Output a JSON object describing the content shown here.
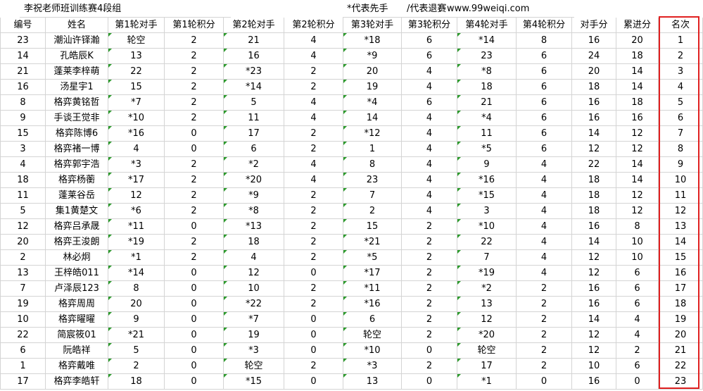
{
  "sheet": {
    "title": "李祝老师班训练赛4段组",
    "legend_first": "*代表先手",
    "legend_quit": "/代表退赛",
    "legend_site": "：www.99weiqi.com",
    "headers": [
      "编号",
      "姓名",
      "第1轮对手",
      "第1轮积分",
      "第2轮对手",
      "第2轮积分",
      "第3轮对手",
      "第3轮积分",
      "第4轮对手",
      "第4轮积分",
      "对手分",
      "累进分",
      "名次"
    ],
    "rows": [
      [
        "23",
        "潮汕许铎瀚",
        "轮空",
        "2",
        "21",
        "4",
        "*18",
        "6",
        "*14",
        "8",
        "16",
        "20",
        "1"
      ],
      [
        "14",
        "孔皓辰K",
        "13",
        "2",
        "16",
        "4",
        "*9",
        "6",
        "23",
        "6",
        "24",
        "18",
        "2"
      ],
      [
        "21",
        "蓬莱李梓萌",
        "22",
        "2",
        "*23",
        "2",
        "20",
        "4",
        "*8",
        "6",
        "20",
        "14",
        "3"
      ],
      [
        "16",
        "汤星宇1",
        "15",
        "2",
        "*14",
        "2",
        "19",
        "4",
        "18",
        "6",
        "18",
        "14",
        "4"
      ],
      [
        "8",
        "格弈黄铭哲",
        "*7",
        "2",
        "5",
        "4",
        "*4",
        "6",
        "21",
        "6",
        "16",
        "18",
        "5"
      ],
      [
        "9",
        "手谈王觉非",
        "*10",
        "2",
        "11",
        "4",
        "14",
        "4",
        "*4",
        "6",
        "16",
        "16",
        "6"
      ],
      [
        "15",
        "格弈陈博6",
        "*16",
        "0",
        "17",
        "2",
        "*12",
        "4",
        "11",
        "6",
        "14",
        "12",
        "7"
      ],
      [
        "3",
        "格弈褚一博",
        "4",
        "0",
        "6",
        "2",
        "1",
        "4",
        "*5",
        "6",
        "12",
        "12",
        "8"
      ],
      [
        "4",
        "格弈郭宇浩",
        "*3",
        "2",
        "*2",
        "4",
        "8",
        "4",
        "9",
        "4",
        "22",
        "14",
        "9"
      ],
      [
        "18",
        "格弈杨蘅",
        "*17",
        "2",
        "*20",
        "4",
        "23",
        "4",
        "*16",
        "4",
        "18",
        "14",
        "10"
      ],
      [
        "11",
        "蓬莱谷岳",
        "12",
        "2",
        "*9",
        "2",
        "7",
        "4",
        "*15",
        "4",
        "18",
        "12",
        "11"
      ],
      [
        "5",
        "集1黄楚文",
        "*6",
        "2",
        "*8",
        "2",
        "2",
        "4",
        "3",
        "4",
        "18",
        "12",
        "12"
      ],
      [
        "12",
        "格弈吕承晟",
        "*11",
        "0",
        "*13",
        "2",
        "15",
        "2",
        "*10",
        "4",
        "16",
        "8",
        "13"
      ],
      [
        "20",
        "格弈王浚朗",
        "*19",
        "2",
        "18",
        "2",
        "*21",
        "2",
        "22",
        "4",
        "14",
        "10",
        "14"
      ],
      [
        "2",
        "林必炯",
        "*1",
        "2",
        "4",
        "2",
        "*5",
        "2",
        "7",
        "4",
        "12",
        "10",
        "15"
      ],
      [
        "13",
        "王梓皓011",
        "*14",
        "0",
        "12",
        "0",
        "*17",
        "2",
        "*19",
        "4",
        "12",
        "6",
        "16"
      ],
      [
        "7",
        "卢泽辰123",
        "8",
        "0",
        "10",
        "2",
        "*11",
        "2",
        "*2",
        "2",
        "16",
        "6",
        "17"
      ],
      [
        "19",
        "格弈周周",
        "20",
        "0",
        "*22",
        "2",
        "*16",
        "2",
        "13",
        "2",
        "16",
        "6",
        "18"
      ],
      [
        "10",
        "格弈曜曜",
        "9",
        "0",
        "*7",
        "0",
        "6",
        "2",
        "12",
        "2",
        "14",
        "4",
        "19"
      ],
      [
        "22",
        "简宸筱01",
        "*21",
        "0",
        "19",
        "0",
        "轮空",
        "2",
        "*20",
        "2",
        "12",
        "4",
        "20"
      ],
      [
        "6",
        "阮皓祥",
        "5",
        "0",
        "*3",
        "0",
        "*10",
        "0",
        "轮空",
        "2",
        "12",
        "2",
        "21"
      ],
      [
        "1",
        "格弈戴唯",
        "2",
        "0",
        "轮空",
        "2",
        "*3",
        "2",
        "17",
        "2",
        "10",
        "6",
        "22"
      ],
      [
        "17",
        "格弈李皓轩",
        "18",
        "0",
        "*15",
        "0",
        "13",
        "0",
        "*1",
        "0",
        "16",
        "0",
        "23"
      ]
    ],
    "marker_color": "#2b9a2b",
    "highlight_color": "#e02020"
  }
}
